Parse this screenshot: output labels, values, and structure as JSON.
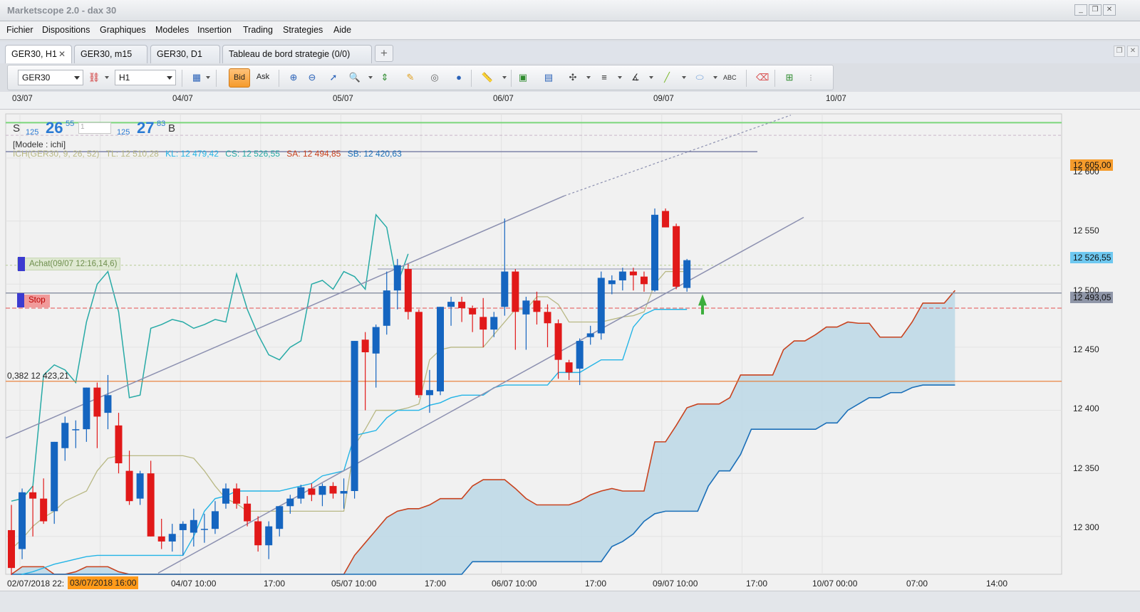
{
  "window": {
    "title": "Marketscope 2.0 - dax 30"
  },
  "menu": [
    "Fichier",
    "Dispositions",
    "Graphiques",
    "Modeles",
    "Insertion",
    "Trading",
    "Strategies",
    "Aide"
  ],
  "tabs": [
    {
      "label": "GER30, H1",
      "active": true
    },
    {
      "label": "GER30, m15"
    },
    {
      "label": "GER30, D1"
    },
    {
      "label": "Tableau de bord strategie (0/0)"
    }
  ],
  "add_tab": "+",
  "toolbar": {
    "instrument": "GER30",
    "timeframe": "H1",
    "bid": "Bid",
    "ask": "Ask"
  },
  "date_ruler": [
    "03/07",
    "04/07",
    "05/07",
    "06/07",
    "09/07",
    "10/07"
  ],
  "quote": {
    "sell_label": "S",
    "buy_label": "B",
    "sell_small": "125",
    "sell_big": "26",
    "sell_sup": "55",
    "buy_small": "125",
    "buy_big": "27",
    "buy_sup": "83",
    "qty": "1"
  },
  "model_label": "[Modele : ichi]",
  "indicator": {
    "name": "ICH(GER30, 9, 26, 52)",
    "tl": "TL: 12 510,28",
    "kl": "KL: 12 479,42",
    "cs": "CS: 12 526,55",
    "sa": "SA: 12 494,85",
    "sb": "SB: 12 420,63"
  },
  "orders": {
    "achat": "Achat(09/07 12:16,14,6)",
    "stop": "Stop"
  },
  "fib_label": "0,382 12 423,21",
  "price_tags": [
    {
      "text": "12 605,00",
      "color": "#f59b2c"
    },
    {
      "text": "12 526,55",
      "color": "#6ec8f0"
    },
    {
      "text": "12 493,05",
      "color": "#8f96a8"
    }
  ],
  "price_axis": [
    "12 600",
    "12 550",
    "12 500",
    "12 450",
    "12 400",
    "12 350",
    "12 300"
  ],
  "time_axis": [
    "02/07/2018 22:",
    "04/07 10:00",
    "17:00",
    "05/07 10:00",
    "17:00",
    "06/07 10:00",
    "17:00",
    "09/07 10:00",
    "17:00",
    "10/07 00:00",
    "07:00",
    "14:00"
  ],
  "time_axis_highlight": "03/07/2018 16:00",
  "colors": {
    "bull": "#1565c0",
    "bear": "#e11919",
    "tenkan": "#b8b884",
    "kijun": "#23b4e6",
    "chikou": "#27aaa6",
    "senkou_a": "#c8421e",
    "senkou_b": "#1b6fb8",
    "cloud": "#bcd8e6",
    "trend": "#8c90b0"
  },
  "chart_data": {
    "type": "candlestick",
    "symbol": "GER30",
    "timeframe": "H1",
    "y_range": [
      12270,
      12635
    ],
    "candles": [
      [
        12305,
        12325,
        12265,
        12275
      ],
      [
        12290,
        12338,
        12282,
        12335
      ],
      [
        12335,
        12340,
        12300,
        12330
      ],
      [
        12330,
        12346,
        12310,
        12312
      ],
      [
        12320,
        12375,
        12310,
        12375
      ],
      [
        12370,
        12395,
        12360,
        12390
      ],
      [
        12385,
        12392,
        12370,
        12385
      ],
      [
        12385,
        12418,
        12375,
        12418
      ],
      [
        12418,
        12422,
        12370,
        12395
      ],
      [
        12398,
        12428,
        12385,
        12412
      ],
      [
        12388,
        12398,
        12350,
        12358
      ],
      [
        12352,
        12368,
        12325,
        12328
      ],
      [
        12330,
        12352,
        12325,
        12350
      ],
      [
        12350,
        12360,
        12300,
        12300
      ],
      [
        12300,
        12314,
        12290,
        12296
      ],
      [
        12296,
        12310,
        12288,
        12302
      ],
      [
        12305,
        12312,
        12285,
        12310
      ],
      [
        12303,
        12322,
        12292,
        12313
      ],
      [
        12306,
        12318,
        12295,
        12306
      ],
      [
        12306,
        12328,
        12302,
        12320
      ],
      [
        12326,
        12342,
        12322,
        12338
      ],
      [
        12338,
        12342,
        12322,
        12326
      ],
      [
        12326,
        12332,
        12308,
        12312
      ],
      [
        12312,
        12316,
        12288,
        12293
      ],
      [
        12293,
        12312,
        12282,
        12308
      ],
      [
        12306,
        12324,
        12300,
        12324
      ],
      [
        12324,
        12333,
        12318,
        12330
      ],
      [
        12330,
        12341,
        12326,
        12339
      ],
      [
        12338,
        12342,
        12328,
        12333
      ],
      [
        12333,
        12342,
        12324,
        12340
      ],
      [
        12340,
        12343,
        12330,
        12334
      ],
      [
        12334,
        12346,
        12322,
        12336
      ],
      [
        12336,
        12455,
        12330,
        12455
      ],
      [
        12456,
        12462,
        12400,
        12446
      ],
      [
        12445,
        12468,
        12418,
        12466
      ],
      [
        12467,
        12510,
        12460,
        12495
      ],
      [
        12495,
        12520,
        12480,
        12515
      ],
      [
        12512,
        12516,
        12472,
        12478
      ],
      [
        12478,
        12480,
        12410,
        12412
      ],
      [
        12412,
        12432,
        12398,
        12416
      ],
      [
        12415,
        12482,
        12412,
        12482
      ],
      [
        12482,
        12490,
        12467,
        12486
      ],
      [
        12486,
        12490,
        12470,
        12481
      ],
      [
        12481,
        12483,
        12462,
        12476
      ],
      [
        12474,
        12489,
        12450,
        12464
      ],
      [
        12464,
        12478,
        12458,
        12474
      ],
      [
        12482,
        12552,
        12475,
        12510
      ],
      [
        12510,
        12512,
        12448,
        12478
      ],
      [
        12476,
        12490,
        12448,
        12487
      ],
      [
        12487,
        12494,
        12468,
        12478
      ],
      [
        12478,
        12484,
        12450,
        12469
      ],
      [
        12469,
        12472,
        12425,
        12440
      ],
      [
        12438,
        12440,
        12424,
        12430
      ],
      [
        12433,
        12457,
        12420,
        12455
      ],
      [
        12458,
        12467,
        12452,
        12461
      ],
      [
        12461,
        12510,
        12456,
        12505
      ],
      [
        12500,
        12507,
        12492,
        12503
      ],
      [
        12503,
        12513,
        12495,
        12510
      ],
      [
        12510,
        12513,
        12495,
        12507
      ],
      [
        12506,
        12510,
        12494,
        12500
      ],
      [
        12495,
        12560,
        12494,
        12555
      ],
      [
        12558,
        12560,
        12545,
        12545
      ],
      [
        12546,
        12548,
        12496,
        12498
      ],
      [
        12497,
        12520,
        12494,
        12519
      ]
    ],
    "tenkan": [
      12290,
      12298,
      12308,
      12315,
      12320,
      12328,
      12332,
      12336,
      12352,
      12362,
      12364,
      12364,
      12364,
      12364,
      12364,
      12364,
      12364,
      12362,
      12352,
      12340,
      12330,
      12326,
      12320,
      12320,
      12320,
      12320,
      12320,
      12320,
      12320,
      12320,
      12320,
      12320,
      12372,
      12385,
      12400,
      12400,
      12400,
      12402,
      12405,
      12440,
      12448,
      12450,
      12450,
      12450,
      12450,
      12460,
      12470,
      12480,
      12480,
      12490,
      12490,
      12484,
      12470,
      12470,
      12470,
      12470,
      12472,
      12474,
      12475,
      12478,
      12500,
      12510,
      12510,
      12510
    ],
    "kijun": [
      12260,
      12270,
      12272,
      12275,
      12278,
      12280,
      12282,
      12284,
      12285,
      12285,
      12285,
      12285,
      12285,
      12285,
      12285,
      12285,
      12285,
      12300,
      12320,
      12330,
      12332,
      12336,
      12336,
      12336,
      12336,
      12336,
      12338,
      12340,
      12342,
      12348,
      12350,
      12352,
      12380,
      12382,
      12384,
      12394,
      12400,
      12400,
      12400,
      12404,
      12406,
      12410,
      12412,
      12412,
      12412,
      12418,
      12420,
      12420,
      12420,
      12420,
      12420,
      12430,
      12430,
      12430,
      12435,
      12440,
      12440,
      12440,
      12466,
      12476,
      12480,
      12480,
      12480,
      12480
    ],
    "chikou": [
      12328,
      12330,
      12340,
      12428,
      12436,
      12432,
      12422,
      12470,
      12500,
      12510,
      12478,
      12410,
      12412,
      12465,
      12468,
      12472,
      12470,
      12465,
      12468,
      12472,
      12470,
      12508,
      12480,
      12460,
      12444,
      12440,
      12450,
      12455,
      12500,
      12503,
      12496,
      12510,
      12506,
      12496,
      12555,
      12545,
      12500,
      12524
    ],
    "senkou_a": [
      12270,
      12276,
      12276,
      12276,
      12270,
      12270,
      12272,
      12276,
      12276,
      12276,
      12272,
      12270,
      12270,
      12270,
      12270,
      12270,
      12270,
      12270,
      12270,
      12270,
      12270,
      12270,
      12270,
      12270,
      12270,
      12270,
      12270,
      12270,
      12270,
      12270,
      12270,
      12270,
      12285,
      12295,
      12305,
      12315,
      12320,
      12322,
      12322,
      12325,
      12330,
      12330,
      12330,
      12340,
      12345,
      12345,
      12345,
      12338,
      12330,
      12325,
      12325,
      12325,
      12325,
      12328,
      12333,
      12336,
      12338,
      12336,
      12336,
      12336,
      12375,
      12375,
      12388,
      12402,
      12405,
      12405,
      12405,
      12410,
      12428,
      12428,
      12428,
      12428,
      12448,
      12455,
      12455,
      12460,
      12466,
      12466,
      12470,
      12469,
      12469,
      12458,
      12458,
      12458,
      12470,
      12485,
      12485,
      12485,
      12495
    ],
    "senkou_b": [
      12270,
      12270,
      12270,
      12270,
      12270,
      12270,
      12270,
      12270,
      12270,
      12270,
      12270,
      12270,
      12270,
      12270,
      12270,
      12270,
      12270,
      12270,
      12270,
      12270,
      12270,
      12270,
      12270,
      12270,
      12270,
      12270,
      12270,
      12270,
      12270,
      12270,
      12270,
      12270,
      12270,
      12270,
      12270,
      12270,
      12270,
      12270,
      12270,
      12270,
      12270,
      12270,
      12270,
      12280,
      12280,
      12280,
      12280,
      12280,
      12280,
      12280,
      12280,
      12280,
      12280,
      12280,
      12280,
      12280,
      12292,
      12296,
      12302,
      12312,
      12318,
      12320,
      12320,
      12320,
      12320,
      12340,
      12352,
      12352,
      12365,
      12385,
      12385,
      12385,
      12385,
      12385,
      12385,
      12385,
      12390,
      12390,
      12400,
      12405,
      12410,
      12410,
      12414,
      12414,
      12418,
      12420,
      12420,
      12420,
      12420
    ]
  }
}
